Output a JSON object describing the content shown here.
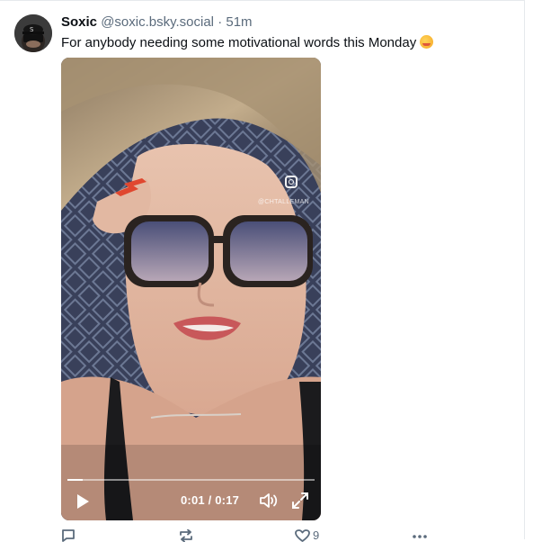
{
  "post": {
    "author_name": "Soxic",
    "handle": "@soxic.bsky.social",
    "separator": "·",
    "time_ago": "51m",
    "text": "For anybody needing some motivational words this Monday",
    "emoji": "hugging-face-emoji"
  },
  "video": {
    "watermark": "@CHTALLEMAN",
    "current_time": "0:01",
    "duration": "0:17",
    "time_display": "0:01 / 0:17",
    "progress": 0.06,
    "icons": {
      "play": "play-icon",
      "volume": "volume-icon",
      "fullscreen": "fullscreen-icon",
      "instagram": "instagram-icon"
    }
  },
  "actions": {
    "reply_icon": "reply-icon",
    "repost_icon": "repost-icon",
    "like_icon": "like-icon",
    "like_count": "9",
    "more_icon": "more-icon"
  },
  "colors": {
    "text": "#0b0f14",
    "muted": "#5b6b7c",
    "divider": "#e6e9ec"
  }
}
